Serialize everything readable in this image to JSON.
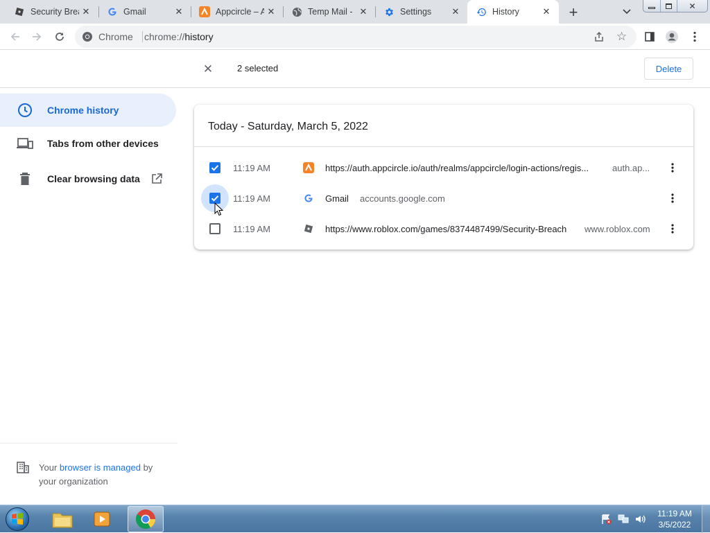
{
  "tabs": [
    {
      "title": "Security Brea",
      "icon": "roblox-icon",
      "active": false
    },
    {
      "title": "Gmail",
      "icon": "google-icon",
      "active": false
    },
    {
      "title": "Appcircle – A",
      "icon": "appcircle-icon",
      "active": false
    },
    {
      "title": "Temp Mail -",
      "icon": "globe-icon",
      "active": false
    },
    {
      "title": "Settings",
      "icon": "gear-icon",
      "active": false
    },
    {
      "title": "History",
      "icon": "history-icon",
      "active": true
    }
  ],
  "omnibox": {
    "site": "Chrome",
    "url_prefix": "chrome://",
    "url_path": "history"
  },
  "selection": {
    "count_label": "2 selected",
    "delete_label": "Delete"
  },
  "sidebar": {
    "items": [
      {
        "label": "Chrome history",
        "icon": "clock-icon",
        "selected": true
      },
      {
        "label": "Tabs from other devices",
        "icon": "devices-icon",
        "selected": false
      },
      {
        "label": "Clear browsing data",
        "icon": "trash-icon",
        "selected": false
      }
    ],
    "managed": {
      "part1": "Your ",
      "link": "browser is managed",
      "part2": " by",
      "line2": "your organization"
    }
  },
  "history": {
    "date_header": "Today - Saturday, March 5, 2022",
    "rows": [
      {
        "checked": true,
        "time": "11:19 AM",
        "icon": "appcircle-icon",
        "title": "https://auth.appcircle.io/auth/realms/appcircle/login-actions/regis...",
        "domain": "auth.ap..."
      },
      {
        "checked": true,
        "time": "11:19 AM",
        "icon": "google-icon",
        "title": "Gmail",
        "domain": "accounts.google.com"
      },
      {
        "checked": false,
        "time": "11:19 AM",
        "icon": "roblox-icon",
        "title": "https://www.roblox.com/games/8374487499/Security-Breach",
        "domain": "www.roblox.com"
      }
    ]
  },
  "taskbar": {
    "time": "11:19 AM",
    "date": "3/5/2022"
  },
  "colors": {
    "accent": "#1a73e8",
    "selected_bg": "#e8f0fe",
    "tabstrip": "#dee1e6"
  }
}
